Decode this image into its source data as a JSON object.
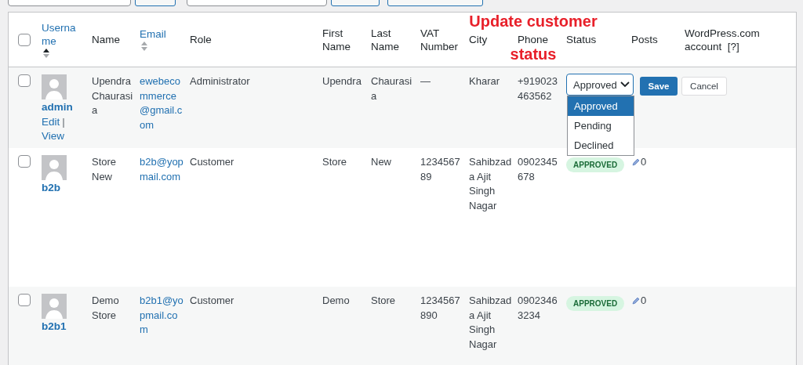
{
  "toolbar": {
    "items": [
      {
        "kind": "field"
      },
      {
        "kind": "button"
      },
      {
        "kind": "field"
      },
      {
        "kind": "button"
      },
      {
        "kind": "button"
      }
    ]
  },
  "annotation": [
    "Update customer",
    "status"
  ],
  "table": {
    "select_all": {
      "checked": false
    },
    "columns": [
      {
        "label": "Username",
        "sortable": true,
        "sorted_ascending": true
      },
      {
        "label": "Name"
      },
      {
        "label": "Email",
        "sortable": true,
        "sorted_ascending": false
      },
      {
        "label": "Role"
      },
      {
        "label": "First Name"
      },
      {
        "label": "Last Name"
      },
      {
        "label": "VAT Number"
      },
      {
        "label": "City"
      },
      {
        "label": "Phone"
      },
      {
        "label": "Status"
      },
      {
        "label": "Posts"
      },
      {
        "label": "WordPress.com account",
        "help": "[?]"
      }
    ],
    "rows": [
      {
        "checked": false,
        "username": "admin",
        "actions": [
          "Edit",
          "View"
        ],
        "action_separator": "|",
        "name": "Upendra Chaurasia",
        "email": "ewebecommerce@gmail.com",
        "role": "Administrator",
        "first_name": "Upendra",
        "last_name": "Chaurasia",
        "vat": "—",
        "city": "Kharar",
        "phone": "+919023463562",
        "status": {
          "kind": "editor",
          "value": "Approved",
          "options": [
            {
              "label": "Approved",
              "selected": true
            },
            {
              "label": "Pending",
              "selected": false
            },
            {
              "label": "Declined",
              "selected": false
            }
          ],
          "save": "Save",
          "cancel": "Cancel"
        }
      },
      {
        "checked": false,
        "username": "b2b",
        "name": "Store New",
        "email": "b2b@yopmail.com",
        "role": "Customer",
        "first_name": "Store",
        "last_name": "New",
        "vat": "123456789",
        "city": "Sahibzada Ajit Singh Nagar",
        "phone": "0902345678",
        "status": {
          "kind": "badge",
          "label": "APPROVED"
        },
        "posts": "0"
      },
      {
        "checked": false,
        "username": "b2b1",
        "name": "Demo Store",
        "email": "b2b1@yopmail.com",
        "role": "Customer",
        "first_name": "Demo",
        "last_name": "Store",
        "vat": "1234567890",
        "city": "Sahibzada Ajit Singh Nagar",
        "phone": "09023463234",
        "status": {
          "kind": "badge",
          "label": "APPROVED"
        },
        "posts": "0"
      }
    ]
  }
}
